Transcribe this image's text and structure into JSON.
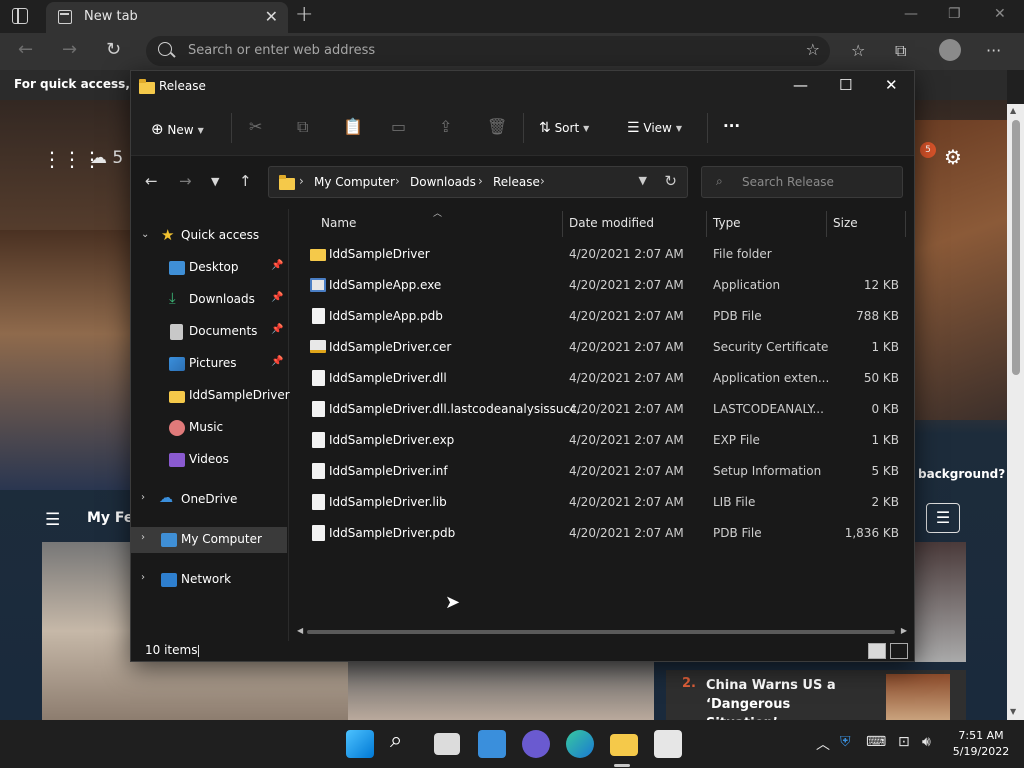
{
  "browser": {
    "tab_title": "New tab",
    "address_placeholder": "Search or enter web address",
    "quick_access_text": "For quick access, plac"
  },
  "page": {
    "weather_partial": "5",
    "notification_count": "5",
    "background_question": "background?",
    "feed_label": "My Fe",
    "news_number": "2.",
    "news_title": "China Warns US a ‘Dangerous Situation’..."
  },
  "explorer": {
    "window_title": "Release",
    "commands": {
      "new_label": "New",
      "sort_label": "Sort",
      "view_label": "View",
      "more_label": "···"
    },
    "breadcrumb": [
      "My Computer",
      "Downloads",
      "Release"
    ],
    "search_placeholder": "Search Release",
    "nav": {
      "quick_access": "Quick access",
      "desktop": "Desktop",
      "downloads": "Downloads",
      "documents": "Documents",
      "pictures": "Pictures",
      "iddsampledriver": "IddSampleDriver",
      "music": "Music",
      "videos": "Videos",
      "onedrive": "OneDrive",
      "mycomputer": "My Computer",
      "network": "Network"
    },
    "columns": {
      "name": "Name",
      "date": "Date modified",
      "type": "Type",
      "size": "Size"
    },
    "files": [
      {
        "name": "IddSampleDriver",
        "date": "4/20/2021 2:07 AM",
        "type": "File folder",
        "size": "",
        "icon": "folder-icon"
      },
      {
        "name": "IddSampleApp.exe",
        "date": "4/20/2021 2:07 AM",
        "type": "Application",
        "size": "12 KB",
        "icon": "application-icon"
      },
      {
        "name": "IddSampleApp.pdb",
        "date": "4/20/2021 2:07 AM",
        "type": "PDB File",
        "size": "788 KB",
        "icon": "file-icon"
      },
      {
        "name": "IddSampleDriver.cer",
        "date": "4/20/2021 2:07 AM",
        "type": "Security Certificate",
        "size": "1 KB",
        "icon": "certificate-icon"
      },
      {
        "name": "IddSampleDriver.dll",
        "date": "4/20/2021 2:07 AM",
        "type": "Application exten...",
        "size": "50 KB",
        "icon": "dll-icon"
      },
      {
        "name": "IddSampleDriver.dll.lastcodeanalysissucc...",
        "date": "4/20/2021 2:07 AM",
        "type": "LASTCODEANALY...",
        "size": "0 KB",
        "icon": "file-icon"
      },
      {
        "name": "IddSampleDriver.exp",
        "date": "4/20/2021 2:07 AM",
        "type": "EXP File",
        "size": "1 KB",
        "icon": "file-icon"
      },
      {
        "name": "IddSampleDriver.inf",
        "date": "4/20/2021 2:07 AM",
        "type": "Setup Information",
        "size": "5 KB",
        "icon": "setup-icon"
      },
      {
        "name": "IddSampleDriver.lib",
        "date": "4/20/2021 2:07 AM",
        "type": "LIB File",
        "size": "2 KB",
        "icon": "file-icon"
      },
      {
        "name": "IddSampleDriver.pdb",
        "date": "4/20/2021 2:07 AM",
        "type": "PDB File",
        "size": "1,836 KB",
        "icon": "file-icon"
      }
    ],
    "status_text": "10 items"
  },
  "taskbar": {
    "time": "7:51 AM",
    "date": "5/19/2022"
  },
  "colors": {
    "accent": "#0078d4",
    "folder": "#f5c94a",
    "notification": "#d9542a"
  }
}
